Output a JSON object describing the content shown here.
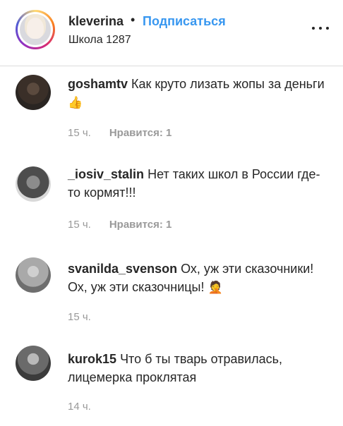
{
  "header": {
    "username": "kleverina",
    "separator": "•",
    "follow_label": "Подписаться",
    "location": "Школа 1287",
    "more_icon": "more-horizontal-icon"
  },
  "comments": [
    {
      "username": "goshamtv",
      "text": "Как круто лизать жопы за деньги",
      "emoji": "👍",
      "time": "15 ч.",
      "likes": "Нравится: 1"
    },
    {
      "username": "_iosiv_stalin",
      "text": "Нет таких школ в России где-то кормят!!!",
      "emoji": "",
      "time": "15 ч.",
      "likes": "Нравится: 1"
    },
    {
      "username": "svanilda_svenson",
      "text": "Ох, уж эти сказочники! Ох, уж эти сказочницы!",
      "emoji": "🤦",
      "time": "15 ч.",
      "likes": ""
    },
    {
      "username": "kurok15",
      "text": "Что б ты тварь отравилась, лицемерка проклятая",
      "emoji": "",
      "time": "14 ч.",
      "likes": ""
    }
  ],
  "colors": {
    "link": "#3897f0",
    "text": "#262626",
    "meta": "#999999"
  }
}
